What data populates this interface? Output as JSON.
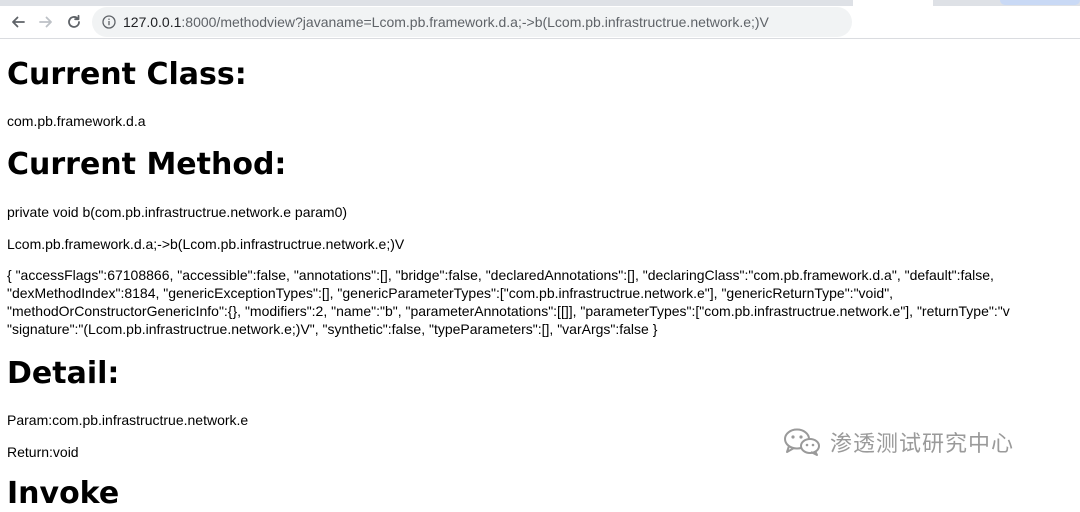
{
  "browser": {
    "url_host": "127.0.0.1",
    "url_path": ":8000/methodview?javaname=Lcom.pb.framework.d.a;->b(Lcom.pb.infrastructrue.network.e;)V"
  },
  "sections": {
    "current_class_heading": "Current Class:",
    "current_class_value": "com.pb.framework.d.a",
    "current_method_heading": "Current Method:",
    "method_signature": "private void b(com.pb.infrastructrue.network.e param0)",
    "method_javaname": "Lcom.pb.framework.d.a;->b(Lcom.pb.infrastructrue.network.e;)V",
    "method_json_lines": [
      "{ \"accessFlags\":67108866, \"accessible\":false, \"annotations\":[], \"bridge\":false, \"declaredAnnotations\":[], \"declaringClass\":\"com.pb.framework.d.a\", \"default\":false,",
      "\"dexMethodIndex\":8184, \"genericExceptionTypes\":[], \"genericParameterTypes\":[\"com.pb.infrastructrue.network.e\"], \"genericReturnType\":\"void\",",
      "\"methodOrConstructorGenericInfo\":{}, \"modifiers\":2, \"name\":\"b\", \"parameterAnnotations\":[[]], \"parameterTypes\":[\"com.pb.infrastructrue.network.e\"], \"returnType\":\"v",
      "\"signature\":\"(Lcom.pb.infrastructrue.network.e;)V\", \"synthetic\":false, \"typeParameters\":[], \"varArgs\":false }"
    ],
    "detail_heading": "Detail:",
    "param_text": "Param:com.pb.infrastructrue.network.e",
    "return_text": "Return:void",
    "next_heading_partial": "Invoke"
  },
  "watermark": {
    "text": "渗透测试研究中心"
  }
}
